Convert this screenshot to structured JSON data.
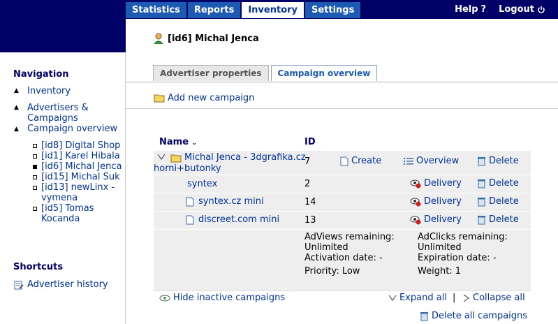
{
  "tabs": [
    {
      "label": "Statistics",
      "active": false
    },
    {
      "label": "Reports",
      "active": false
    },
    {
      "label": "Inventory",
      "active": true
    },
    {
      "label": "Settings",
      "active": false
    }
  ],
  "topright": {
    "help": "Help",
    "logout": "Logout"
  },
  "sidebar": {
    "navigation_title": "Navigation",
    "inventory": "Inventory",
    "advertisers": "Advertisers &",
    "advertisers2": "Campaigns",
    "campaign_overview": "Campaign overview",
    "advertisers_list": [
      "[id8] Digital Shop",
      "[id1] Karel Hibala",
      "[id6] Michal Jenca",
      "[id15] Michal Suk",
      "[id13] newLinx -",
      "vymena",
      "[id5] Tomas",
      "Kocanda"
    ],
    "shortcuts_title": "Shortcuts",
    "advertiser_history": "Advertiser history"
  },
  "header": {
    "title": "[id6] Michal Jenca"
  },
  "content_tabs": [
    {
      "label": "Advertiser properties",
      "active": false
    },
    {
      "label": "Campaign overview",
      "active": true
    }
  ],
  "add_new_campaign": "Add new campaign",
  "table": {
    "col_name": "Name",
    "col_id": "ID",
    "campaign": {
      "name_line1": "Michal Jenca - 3dgrafika.cz",
      "name_line2": "horni+butonky",
      "id": "7",
      "create": "Create",
      "overview": "Overview",
      "delete": "Delete"
    },
    "banners": [
      {
        "name": "syntex",
        "id": "2",
        "delivery": "Delivery",
        "delete": "Delete"
      },
      {
        "name": "syntex.cz mini",
        "id": "14",
        "delivery": "Delivery",
        "delete": "Delete"
      },
      {
        "name": "discreet.com mini",
        "id": "13",
        "delivery": "Delivery",
        "delete": "Delete"
      }
    ],
    "details": {
      "adviews": "AdViews remaining:",
      "adviews_val": "Unlimited",
      "adclicks": "AdClicks remaining:",
      "adclicks_val": "Unlimited",
      "activation": "Activation date: -",
      "expiration": "Expiration date: -",
      "priority": "Priority: Low",
      "weight": "Weight: 1"
    }
  },
  "footer": {
    "hide_inactive": "Hide inactive campaigns",
    "expand_all": "Expand all",
    "separator": "|",
    "collapse_all": "Collapse all",
    "delete_all": "Delete all campaigns"
  },
  "colors": {
    "nav_dark": "#000066",
    "tab_blue": "#1c5ab4",
    "link": "#003399",
    "row_bg": "#eeeeee"
  }
}
